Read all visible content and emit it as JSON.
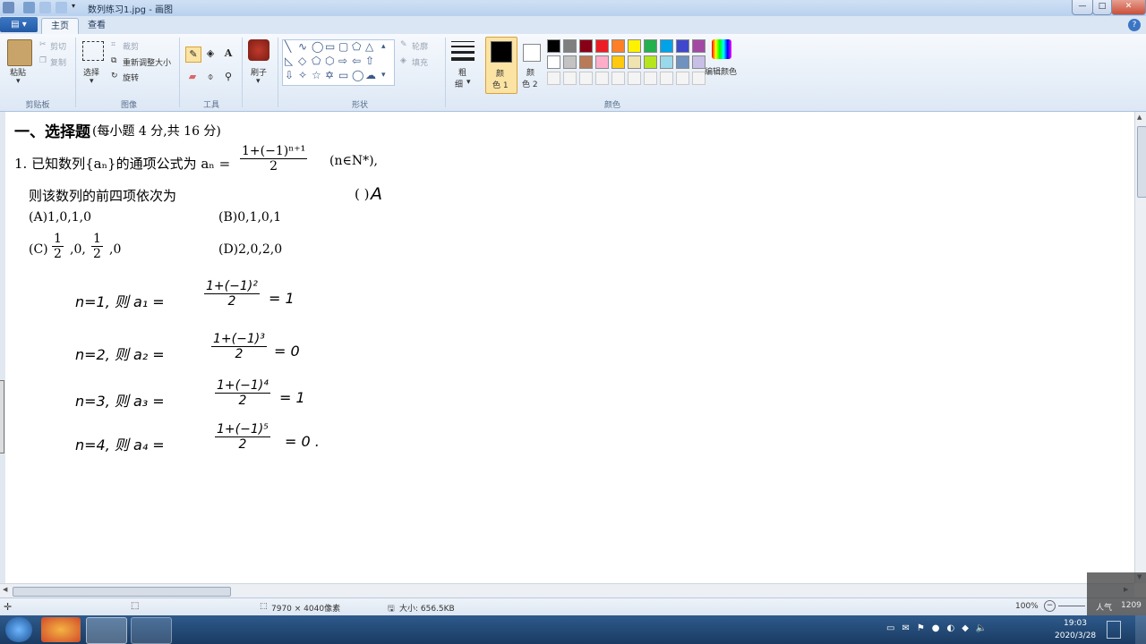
{
  "window": {
    "title": "数列练习1.jpg - 画图",
    "min": "—",
    "max": "□",
    "close": "✕"
  },
  "tabs": {
    "file_menu": "▤ ▾",
    "home": "主页",
    "view": "查看"
  },
  "ribbon": {
    "clipboard": {
      "paste": "粘贴",
      "cut": "剪切",
      "copy": "复制",
      "label": "剪贴板"
    },
    "image": {
      "select": "选择",
      "crop": "裁剪",
      "resize": "重新调整大小",
      "rotate": "旋转",
      "label": "图像"
    },
    "tools": {
      "label": "工具"
    },
    "brushes": {
      "label": "刷子"
    },
    "shapes": {
      "outline": "轮廓",
      "fill": "填充",
      "label": "形状"
    },
    "size": {
      "label1": "粗",
      "label2": "细"
    },
    "color1": {
      "label1": "颜",
      "label2": "色 1"
    },
    "color2": {
      "label1": "颜",
      "label2": "色 2"
    },
    "edit_colors": "编辑颜色",
    "colors_label": "颜色",
    "palette_row1": [
      "#000000",
      "#7f7f7f",
      "#880015",
      "#ed1c24",
      "#ff7f27",
      "#fff200",
      "#22b14c",
      "#00a2e8",
      "#3f48cc",
      "#a349a4"
    ],
    "palette_row2": [
      "#ffffff",
      "#c3c3c3",
      "#b97a57",
      "#ffaec9",
      "#ffc90e",
      "#efe4b0",
      "#b5e61d",
      "#99d9ea",
      "#7092be",
      "#c8bfe7"
    ]
  },
  "document": {
    "heading_bold": "一、选择题",
    "heading_rest": "(每小题 4 分,共 16 分)",
    "q1_prefix": "1. 已知数列{aₙ}的通项公式为 aₙ =",
    "q1_num": "1+(−1)ⁿ⁺¹",
    "q1_den": "2",
    "q1_suffix": "(n∈N*),",
    "q1_line2": "则该数列的前四项依次为",
    "answer_paren": "(   )",
    "answer": "A",
    "options": {
      "a": "(A)1,0,1,0",
      "b": "(B)0,1,0,1",
      "c_prefix": "(C)",
      "c_f1_num": "1",
      "c_f1_den": "2",
      "c_mid": ",0,",
      "c_f2_num": "1",
      "c_f2_den": "2",
      "c_suffix": ",0",
      "d": "(D)2,0,2,0"
    },
    "handwriting": [
      {
        "lhs": "n=1, 则 a₁ =",
        "num": "1+(−1)²",
        "den": "2",
        "rhs": "= 1"
      },
      {
        "lhs": "n=2, 则 a₂ =",
        "num": "1+(−1)³",
        "den": "2",
        "rhs": "= 0"
      },
      {
        "lhs": "n=3, 则 a₃ =",
        "num": "1+(−1)⁴",
        "den": "2",
        "rhs": "= 1"
      },
      {
        "lhs": "n=4, 则 a₄ =",
        "num": "1+(−1)⁵",
        "den": "2",
        "rhs": "= 0 ."
      }
    ]
  },
  "statusbar": {
    "dimensions": "7970 × 4040像素",
    "size": "大小: 656.5KB",
    "zoom": "100%"
  },
  "watermark": {
    "label": "人气",
    "value": "1209"
  },
  "taskbar": {
    "time": "19:03",
    "date": "2020/3/28"
  }
}
